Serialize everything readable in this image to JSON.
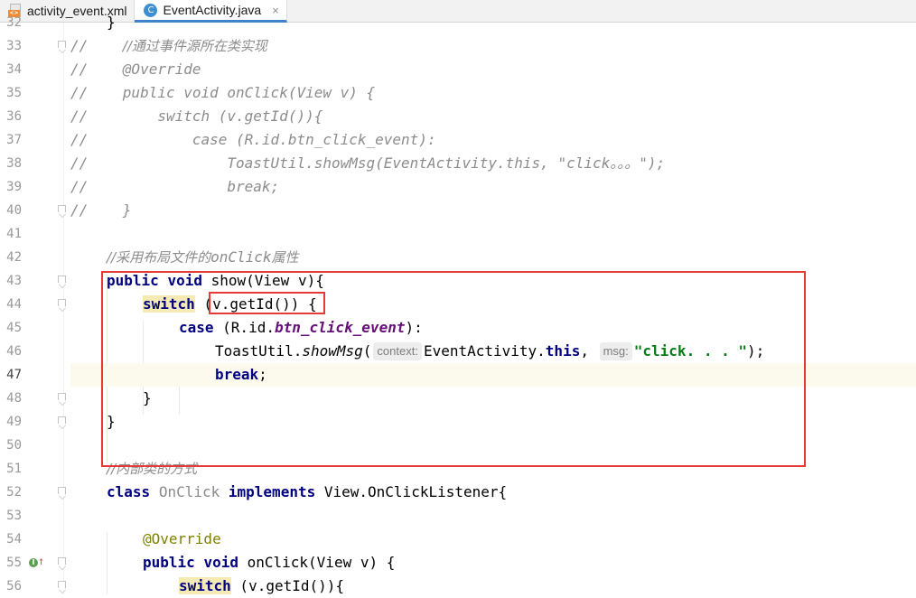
{
  "tabs": [
    {
      "label": "activity_event.xml",
      "icon": "xml-file-icon",
      "active": false
    },
    {
      "label": "EventActivity.java",
      "icon": "java-class-icon",
      "active": true,
      "close": "×"
    }
  ],
  "lines": [
    {
      "n": "32"
    },
    {
      "n": "33"
    },
    {
      "n": "34"
    },
    {
      "n": "35"
    },
    {
      "n": "36"
    },
    {
      "n": "37"
    },
    {
      "n": "38"
    },
    {
      "n": "39"
    },
    {
      "n": "40"
    },
    {
      "n": "41"
    },
    {
      "n": "42"
    },
    {
      "n": "43"
    },
    {
      "n": "44"
    },
    {
      "n": "45"
    },
    {
      "n": "46"
    },
    {
      "n": "47"
    },
    {
      "n": "48"
    },
    {
      "n": "49"
    },
    {
      "n": "50"
    },
    {
      "n": "51"
    },
    {
      "n": "52"
    },
    {
      "n": "53"
    },
    {
      "n": "54"
    },
    {
      "n": "55"
    },
    {
      "n": "56"
    }
  ],
  "code": {
    "l32": "}",
    "l33_a": "//    ",
    "l33_b": "//通过事件源所在类实现",
    "l34": "//    @Override",
    "l35": "//    public void onClick(View v) {",
    "l36": "//        switch (v.getId()){",
    "l37": "//            case (R.id.btn_click_event):",
    "l38": "//                ToastUtil.showMsg(EventActivity.this, \"click。。。\");",
    "l39": "//                break;",
    "l40": "//    }",
    "l42_a": "//采用布局文件的",
    "l42_b": "onClick",
    "l42_c": "属性",
    "l43_kw1": "public",
    "l43_kw2": "void",
    "l43_m": "show(View v)",
    "l43_e": "{",
    "l44_kw": "switch",
    "l44_e": " (v.getId()) {",
    "l45_kw": "case",
    "l45_a": " (R.id.",
    "l45_f": "btn_click_event",
    "l45_e": "):",
    "l46_a": "ToastUtil.",
    "l46_m": "showMsg",
    "l46_b": "(",
    "l46_hint1": "context:",
    "l46_c": "EventActivity.",
    "l46_kw": "this",
    "l46_d": ", ",
    "l46_hint2": "msg:",
    "l46_str": "\"click. . . \"",
    "l46_e": ");",
    "l47_kw": "break",
    "l47_e": ";",
    "l48": "}",
    "l49": "}",
    "l51": "//内部类的方式",
    "l52_kw": "class",
    "l52_name": "OnClick",
    "l52_kw2": "implements",
    "l52_e": "View.OnClickListener{",
    "l54": "@Override",
    "l55_kw1": "public",
    "l55_kw2": "void",
    "l55_e": "onClick(View v) {",
    "l56_kw": "switch",
    "l56_e": " (v.getId()){"
  },
  "colors": {
    "keyword": "#000080",
    "comment": "#8c8c8c",
    "annotation": "#808000",
    "field": "#660e7a",
    "string": "#067d17",
    "highlight_box": "#e53935",
    "current_line": "#fcfaed"
  }
}
